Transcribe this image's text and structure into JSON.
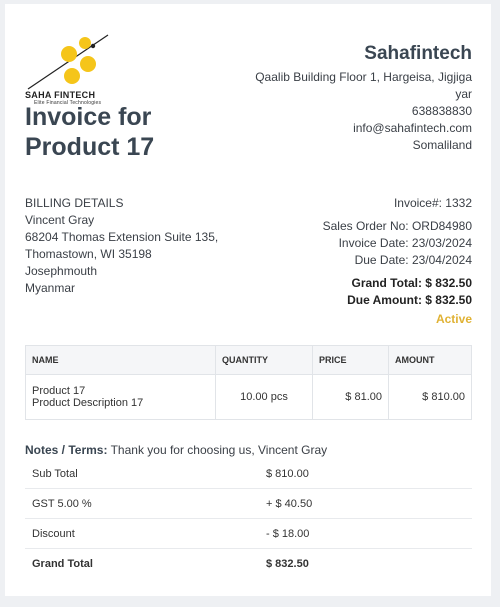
{
  "logo": {
    "name": "SAHA FINTECH",
    "tagline": "Elite Financial Technologies",
    "colors": {
      "dots": "#f5c51a",
      "line": "#222222"
    }
  },
  "title_line1": "Invoice for",
  "title_line2": "Product 17",
  "company": {
    "name": "Sahafintech",
    "address_line1": "Qaalib Building Floor 1, Hargeisa, Jigjiga",
    "address_line2": "yar",
    "phone": "638838830",
    "email": "info@sahafintech.com",
    "country": "Somaliland"
  },
  "billing": {
    "heading": "BILLING DETAILS",
    "name": "Vincent Gray",
    "address_line1": "68204 Thomas Extension Suite 135,",
    "address_line2": "Thomastown, WI 35198",
    "city": "Josephmouth",
    "country": "Myanmar"
  },
  "invoice": {
    "number": "Invoice#: 1332",
    "sales_order": "Sales Order No: ORD84980",
    "invoice_date": "Invoice Date: 23/03/2024",
    "due_date": "Due Date: 23/04/2024",
    "grand_total": "Grand Total: $ 832.50",
    "due_amount": "Due Amount: $ 832.50",
    "status": "Active",
    "status_color": "#e0b234"
  },
  "table": {
    "headers": [
      "NAME",
      "QUANTITY",
      "PRICE",
      "AMOUNT"
    ],
    "rows": [
      {
        "name": "Product 17",
        "description": "Product Description 17",
        "quantity": "10.00 pcs",
        "price": "$ 81.00",
        "amount": "$ 810.00"
      }
    ]
  },
  "notes": {
    "label": "Notes / Terms:",
    "text": "Thank you for choosing us, Vincent Gray"
  },
  "totals": [
    {
      "label": "Sub Total",
      "value": "$ 810.00"
    },
    {
      "label": "GST 5.00 %",
      "value": "+ $ 40.50"
    },
    {
      "label": "Discount",
      "value": "- $ 18.00"
    },
    {
      "label": "Grand Total",
      "value": "$ 832.50"
    }
  ]
}
